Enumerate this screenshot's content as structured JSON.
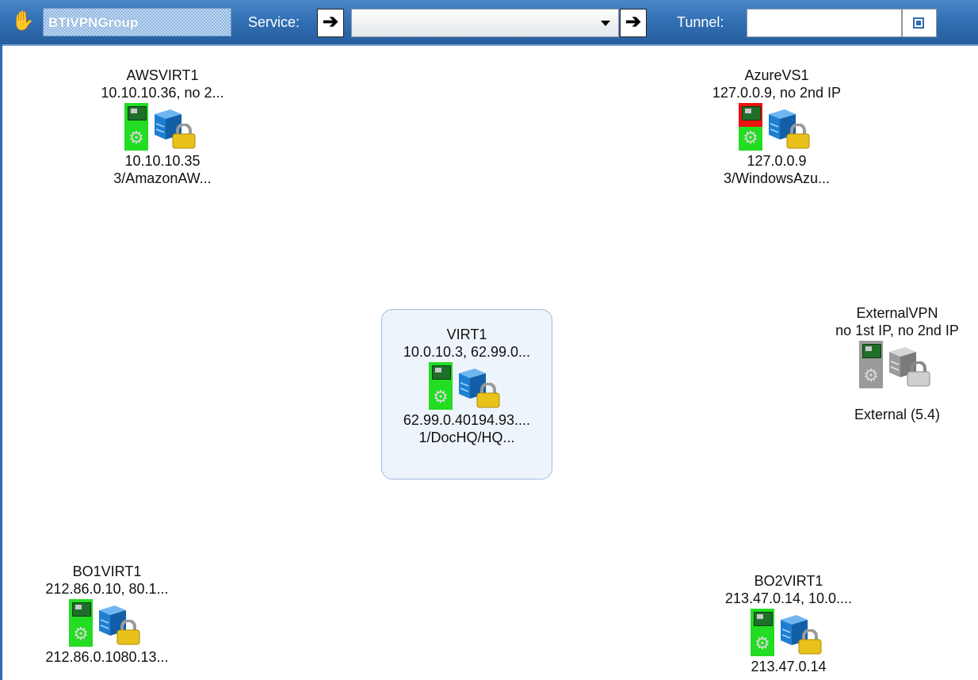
{
  "toolbar": {
    "group_name": "BTIVPNGroup",
    "service_label": "Service:",
    "service_value": "",
    "tunnel_label": "Tunnel:",
    "tunnel_value": "",
    "go_arrow": "➔",
    "hand_glyph": "✋"
  },
  "nodes": [
    {
      "name": "AWSVIRT1",
      "ips": "10.10.10.36, no 2...",
      "sub1": "10.10.10.35",
      "sub2": "3/AmazonAW...",
      "nic_status": "green",
      "selected": false
    },
    {
      "name": "AzureVS1",
      "ips": "127.0.0.9, no 2nd IP",
      "sub1": "127.0.0.9",
      "sub2": "3/WindowsAzu...",
      "nic_status": "red",
      "selected": false
    },
    {
      "name": "ExternalVPN",
      "ips": "no 1st IP, no 2nd IP",
      "sub1": "",
      "sub2": "External (5.4)",
      "nic_status": "gray",
      "selected": false
    },
    {
      "name": "VIRT1",
      "ips": "10.0.10.3, 62.99.0...",
      "sub1": "62.99.0.40194.93....",
      "sub2": "1/DocHQ/HQ...",
      "nic_status": "green",
      "selected": true
    },
    {
      "name": "BO1VIRT1",
      "ips": "212.86.0.10, 80.1...",
      "sub1": "212.86.0.1080.13...",
      "sub2": "",
      "nic_status": "green",
      "selected": false
    },
    {
      "name": "BO2VIRT1",
      "ips": "213.47.0.14, 10.0....",
      "sub1": "213.47.0.14",
      "sub2": "",
      "nic_status": "green",
      "selected": false
    }
  ],
  "colors": {
    "toolbar": "#2f6cb0",
    "nic_ok": "#22dd22",
    "nic_error": "#ee1111",
    "nic_external": "#9a9a9a",
    "server_blue": "#1e7fd0",
    "lock_gold": "#e8c21a"
  }
}
